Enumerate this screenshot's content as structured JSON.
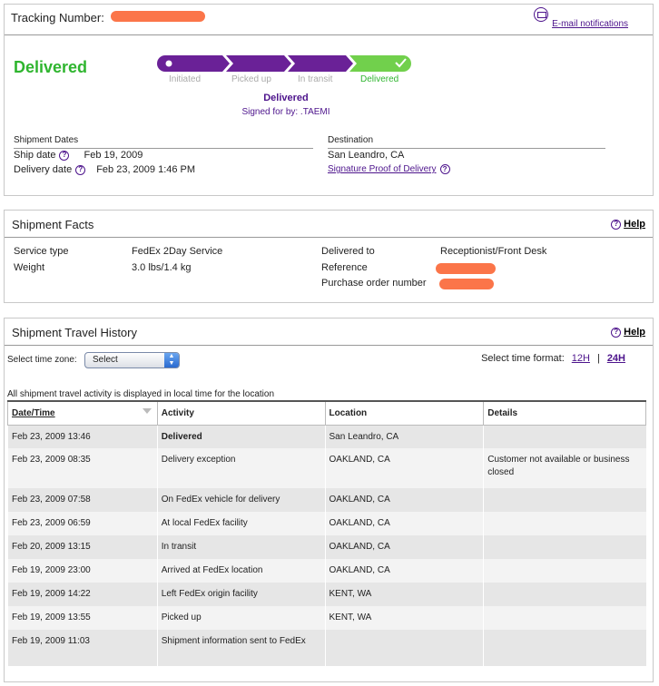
{
  "tracking": {
    "label": "Tracking Number:",
    "email_label": "E-mail notifications",
    "status_big": "Delivered",
    "stages": [
      "Initiated",
      "Picked up",
      "In transit",
      "Delivered"
    ],
    "status_line": "Delivered",
    "signed_for": "Signed for by: .TAEMI",
    "colors": {
      "purple": "#6a2197",
      "green": "#71d04c",
      "redact": "#fb7549"
    }
  },
  "dates": {
    "header": "Shipment Dates",
    "ship_label": "Ship date",
    "ship_value": "Feb 19, 2009",
    "delivery_label": "Delivery date",
    "delivery_value": "Feb 23, 2009 1:46 PM"
  },
  "destination": {
    "header": "Destination",
    "city": "San Leandro, CA",
    "proof_link": "Signature Proof of Delivery"
  },
  "facts": {
    "title": "Shipment Facts",
    "help": "Help",
    "service_label": "Service type",
    "service_value": "FedEx 2Day Service",
    "weight_label": "Weight",
    "weight_value": "3.0 lbs/1.4 kg",
    "delivered_to_label": "Delivered to",
    "delivered_to_value": "Receptionist/Front Desk",
    "reference_label": "Reference",
    "po_label": "Purchase order number"
  },
  "history": {
    "title": "Shipment Travel History",
    "help": "Help",
    "tz_label": "Select time zone:",
    "tz_value": "Select",
    "format_label": "Select time format:",
    "format_12": "12H",
    "format_sep": "|",
    "format_24": "24H",
    "note": "All shipment travel activity is displayed in local time for the location",
    "columns": [
      "Date/Time",
      "Activity",
      "Location",
      "Details"
    ],
    "rows": [
      [
        "Feb 23, 2009 13:46",
        "Delivered",
        "San Leandro, CA",
        ""
      ],
      [
        "Feb 23, 2009 08:35",
        "Delivery exception",
        "OAKLAND, CA",
        "Customer not available or business closed"
      ],
      [
        "Feb 23, 2009 07:58",
        "On FedEx vehicle for delivery",
        "OAKLAND, CA",
        ""
      ],
      [
        "Feb 23, 2009 06:59",
        "At local FedEx facility",
        "OAKLAND, CA",
        ""
      ],
      [
        "Feb 20, 2009 13:15",
        "In transit",
        "OAKLAND, CA",
        ""
      ],
      [
        "Feb 19, 2009 23:00",
        "Arrived at FedEx location",
        "OAKLAND, CA",
        ""
      ],
      [
        "Feb 19, 2009 14:22",
        "Left FedEx origin facility",
        "KENT, WA",
        ""
      ],
      [
        "Feb 19, 2009 13:55",
        "Picked up",
        "KENT, WA",
        ""
      ],
      [
        "Feb 19, 2009 11:03",
        "Shipment information sent to FedEx",
        "",
        ""
      ]
    ]
  }
}
